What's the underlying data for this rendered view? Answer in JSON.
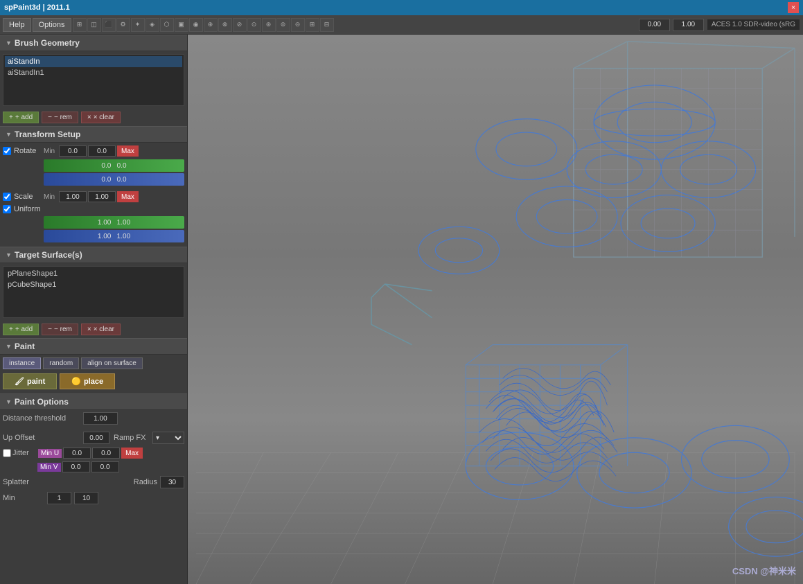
{
  "titlebar": {
    "title": "spPaint3d | 2011.1",
    "close": "×"
  },
  "menu": {
    "help": "Help",
    "options": "Options"
  },
  "toolbar": {
    "value1": "0.00",
    "value2": "1.00",
    "aces_label": "ACES 1.0 SDR-video (sRG"
  },
  "brush_geometry": {
    "header": "Brush Geometry",
    "items": [
      "aiStandIn",
      "aiStandIn1"
    ],
    "add_label": "+ add",
    "rem_label": "− rem",
    "clear_label": "× clear"
  },
  "transform_setup": {
    "header": "Transform Setup",
    "rotate": {
      "label": "Rotate",
      "checked": true,
      "min_label": "Min",
      "val1": "0.0",
      "val2": "0.0",
      "max_label": "Max",
      "green_val1": "0.0",
      "green_val2": "0.0",
      "blue_val1": "0.0",
      "blue_val2": "0.0"
    },
    "scale": {
      "label": "Scale",
      "checked": true,
      "min_label": "Min",
      "val1": "1.00",
      "val2": "1.00",
      "max_label": "Max"
    },
    "uniform": {
      "label": "Uniform",
      "checked": true,
      "green_val1": "1.00",
      "green_val2": "1.00",
      "blue_val1": "1.00",
      "blue_val2": "1.00"
    }
  },
  "target_surfaces": {
    "header": "Target Surface(s)",
    "items": [
      "pPlaneShape1",
      "pCubeShape1"
    ],
    "add_label": "+ add",
    "rem_label": "− rem",
    "clear_label": "× clear"
  },
  "paint_section": {
    "header": "Paint",
    "mode_instance": "instance",
    "mode_random": "random",
    "mode_align": "align on surface",
    "paint_btn": "paint",
    "place_btn": "place"
  },
  "paint_options": {
    "header": "Paint Options",
    "distance_threshold_label": "Distance threshold",
    "distance_threshold_value": "1.00",
    "up_offset_label": "Up Offset",
    "up_offset_value": "0.00",
    "ramp_fx_label": "Ramp FX",
    "jitter_label": "Jitter",
    "jitter_checked": false,
    "jitter_min_u": "Min U",
    "jitter_u_val1": "0.0",
    "jitter_u_val2": "0.0",
    "jitter_max": "Max",
    "jitter_min_v": "Min V",
    "jitter_v_val1": "0.0",
    "jitter_v_val2": "0.0",
    "splatter_label": "Splatter",
    "radius_label": "Radius",
    "radius_value": "30",
    "min_label": "Min",
    "min_value": "1",
    "max_value": "10"
  }
}
